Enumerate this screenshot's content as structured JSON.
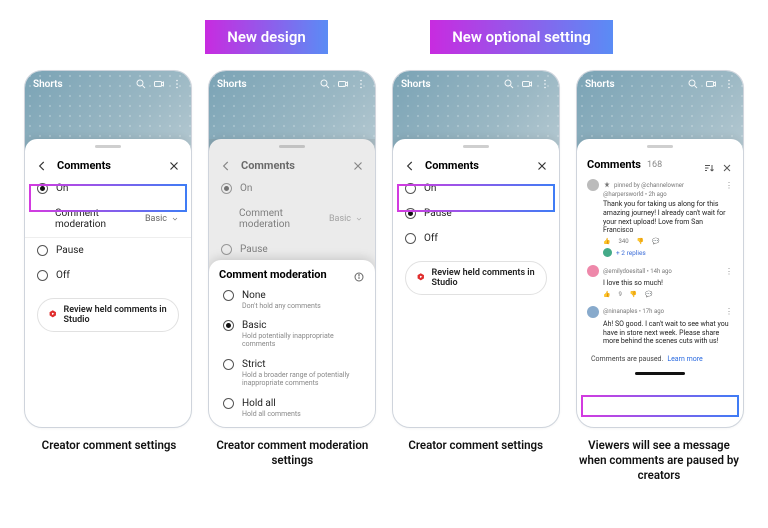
{
  "badges": {
    "left": "New design",
    "right": "New optional setting"
  },
  "topbar": {
    "title": "Shorts"
  },
  "sheet": {
    "title": "Comments",
    "options": {
      "on": "On",
      "pause": "Pause",
      "off": "Off"
    },
    "moderation_label": "Comment moderation",
    "moderation_value": "Basic",
    "review_label": "Review held comments in Studio"
  },
  "moderation": {
    "title": "Comment moderation",
    "none": {
      "label": "None",
      "desc": "Don't hold any comments"
    },
    "basic": {
      "label": "Basic",
      "desc": "Hold potentially inappropriate comments"
    },
    "strict": {
      "label": "Strict",
      "desc": "Hold a broader range of potentially inappropriate comments"
    },
    "holdall": {
      "label": "Hold all",
      "desc": "Hold all comments"
    }
  },
  "viewer": {
    "count": "168",
    "pinned_label": "pinned by @channelowner",
    "c1": {
      "meta": "@harpersworld • 2h ago",
      "body": "Thank you for taking us along for this amazing journey! I already can't wait for your next upload! Love from San Francisco",
      "likes": "340",
      "replies": "+ 2 replies"
    },
    "c2": {
      "meta": "@emilydoesitall • 14h ago",
      "body": "I love this so much!",
      "likes": "9"
    },
    "c3": {
      "meta": "@ninanaples • 17h ago",
      "body": "Ah! SO good. I can't wait to see what you have in store next week. Please share more behind the scenes cuts with us!"
    },
    "paused": "Comments are paused.",
    "learn": "Learn more"
  },
  "captions": {
    "p1": "Creator comment settings",
    "p2": "Creator comment moderation settings",
    "p3": "Creator comment settings",
    "p4": "Viewers will see a message when comments are paused by creators"
  }
}
